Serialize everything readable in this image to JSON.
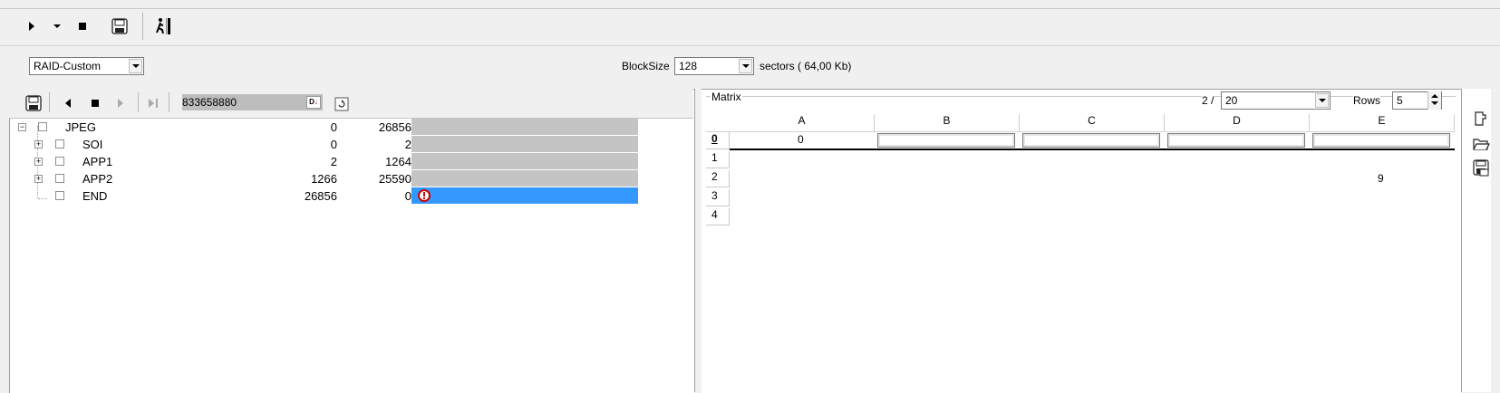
{
  "toolbar": {
    "play_icon": "play-icon",
    "dropdown_icon": "chevron-down-icon",
    "stop_icon": "stop-icon",
    "save_icon": "save-icon",
    "run_icon": "runner-icon"
  },
  "options": {
    "raid_select": "RAID-Custom",
    "blocksize_label": "BlockSize",
    "blocksize_value": "128",
    "sectors_text": "sectors ( 64,00 Kb)"
  },
  "left_toolbar": {
    "offset_value": "833658880"
  },
  "tree": [
    {
      "name": "JPEG",
      "start": "0",
      "length": "26856",
      "expandable": false,
      "root": true
    },
    {
      "name": "SOI",
      "start": "0",
      "length": "2",
      "expandable": true
    },
    {
      "name": "APP1",
      "start": "2",
      "length": "1264",
      "expandable": true
    },
    {
      "name": "APP2",
      "start": "1266",
      "length": "25590",
      "expandable": true
    },
    {
      "name": "END",
      "start": "26856",
      "length": "0",
      "expandable": false,
      "selected": true,
      "warning": true
    }
  ],
  "matrix": {
    "label": "Matrix",
    "page_prefix": "2 /",
    "page_total": "20",
    "rows_label": "Rows",
    "rows_value": "5",
    "columns": [
      "A",
      "B",
      "C",
      "D",
      "E"
    ],
    "row_numbers": [
      "0",
      "1",
      "2",
      "3",
      "4"
    ],
    "row0_a": "0",
    "row2_e": "9"
  },
  "right_toolbar": {
    "icons": [
      "puzzle-icon",
      "folder-open-icon",
      "save-as-icon"
    ]
  },
  "colors": {
    "selection": "#3399ff",
    "bar": "#c4c4c4"
  }
}
